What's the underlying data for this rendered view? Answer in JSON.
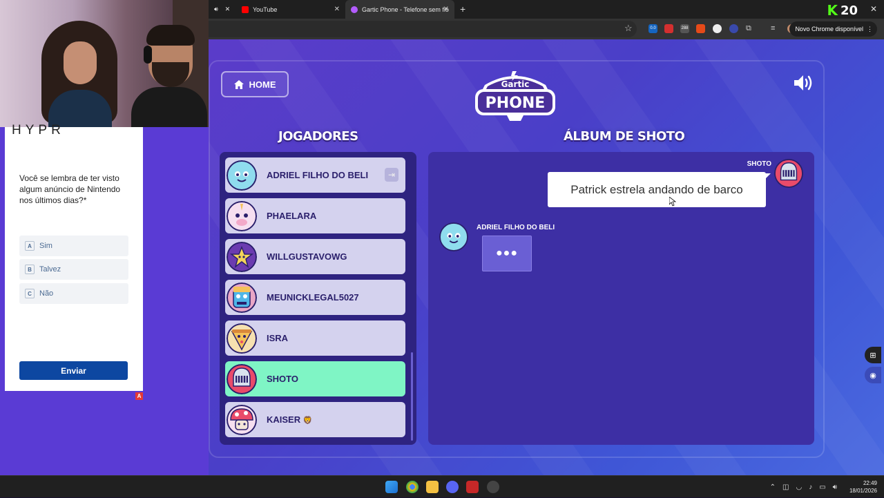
{
  "browser": {
    "tabs": [
      {
        "label": "YouTube",
        "favicon_color": "#ff0000"
      },
      {
        "label": "Gartic Phone - Telefone sem fio",
        "favicon_color": "#b35cff",
        "active": true
      }
    ],
    "new_tab_symbol": "+",
    "kick_badge": "20",
    "update_button": "Novo Chrome disponível",
    "extension_badge_1": "0.0",
    "extension_badge_2": "288"
  },
  "survey": {
    "brand": "HYPR",
    "question": "Você se lembra de ter visto algum anúncio de Nintendo nos últimos dias?*",
    "options": [
      {
        "letter": "A",
        "label": "Sim"
      },
      {
        "letter": "B",
        "label": "Talvez"
      },
      {
        "letter": "C",
        "label": "Não"
      }
    ],
    "submit_label": "Enviar",
    "adchoice": "A"
  },
  "game": {
    "home_label": "HOME",
    "logo_top": "Gartic",
    "logo_bottom": "PHONE",
    "players_heading": "JOGADORES",
    "album_heading": "ÁLBUM DE SHOTO",
    "players": [
      {
        "name": "ADRIEL FILHO DO BELI",
        "avatar": "ghost-avatar",
        "color": "#7fd6e8",
        "kick": true
      },
      {
        "name": "PHAELARA",
        "avatar": "unicorn-avatar",
        "color": "#f3c6df"
      },
      {
        "name": "WILLGUSTAVOWG",
        "avatar": "star-avatar",
        "color": "#6b3bb0"
      },
      {
        "name": "MEUNICKLEGAL5027",
        "avatar": "blue-monster-avatar",
        "color": "#4fb6e8"
      },
      {
        "name": "ISRA",
        "avatar": "pizza-avatar",
        "color": "#f4c25a"
      },
      {
        "name": "SHOTO",
        "avatar": "knight-avatar",
        "color": "#c9d6e6",
        "active": true
      },
      {
        "name": "KAISER",
        "emoji": "🦁",
        "avatar": "mushroom-avatar",
        "color": "#e94b6a"
      }
    ],
    "album": {
      "owner": "SHOTO",
      "prompt": "Patrick estrela andando de barco",
      "answer_author": "ADRIEL FILHO DO BELI",
      "typing_indicator": "●●●"
    }
  },
  "taskbar": {
    "time": "22:49",
    "date": "18/01/2026"
  }
}
